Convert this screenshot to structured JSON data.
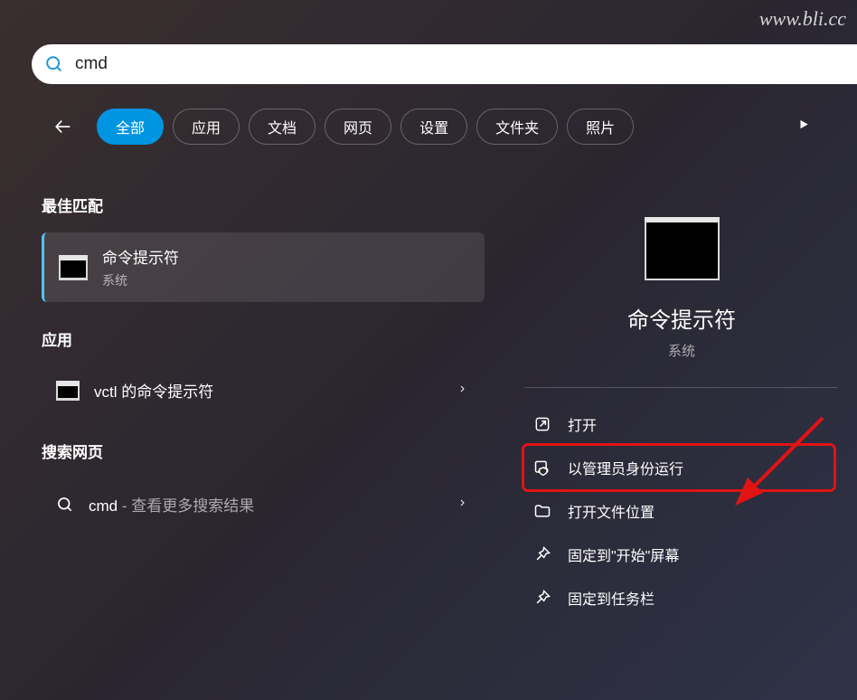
{
  "watermark": "www.bli.cc",
  "search": {
    "value": "cmd"
  },
  "filters": {
    "items": [
      "全部",
      "应用",
      "文档",
      "网页",
      "设置",
      "文件夹",
      "照片"
    ],
    "active_index": 0
  },
  "sections": {
    "best_match_label": "最佳匹配",
    "apps_label": "应用",
    "web_label": "搜索网页"
  },
  "best_match": {
    "title": "命令提示符",
    "subtitle": "系统"
  },
  "app_result": {
    "title": "vctl 的命令提示符"
  },
  "web_result": {
    "prefix": "cmd",
    "suffix": " - 查看更多搜索结果"
  },
  "details": {
    "title": "命令提示符",
    "subtitle": "系统",
    "actions": {
      "open": "打开",
      "run_admin": "以管理员身份运行",
      "open_location": "打开文件位置",
      "pin_start": "固定到\"开始\"屏幕",
      "pin_taskbar": "固定到任务栏"
    }
  }
}
